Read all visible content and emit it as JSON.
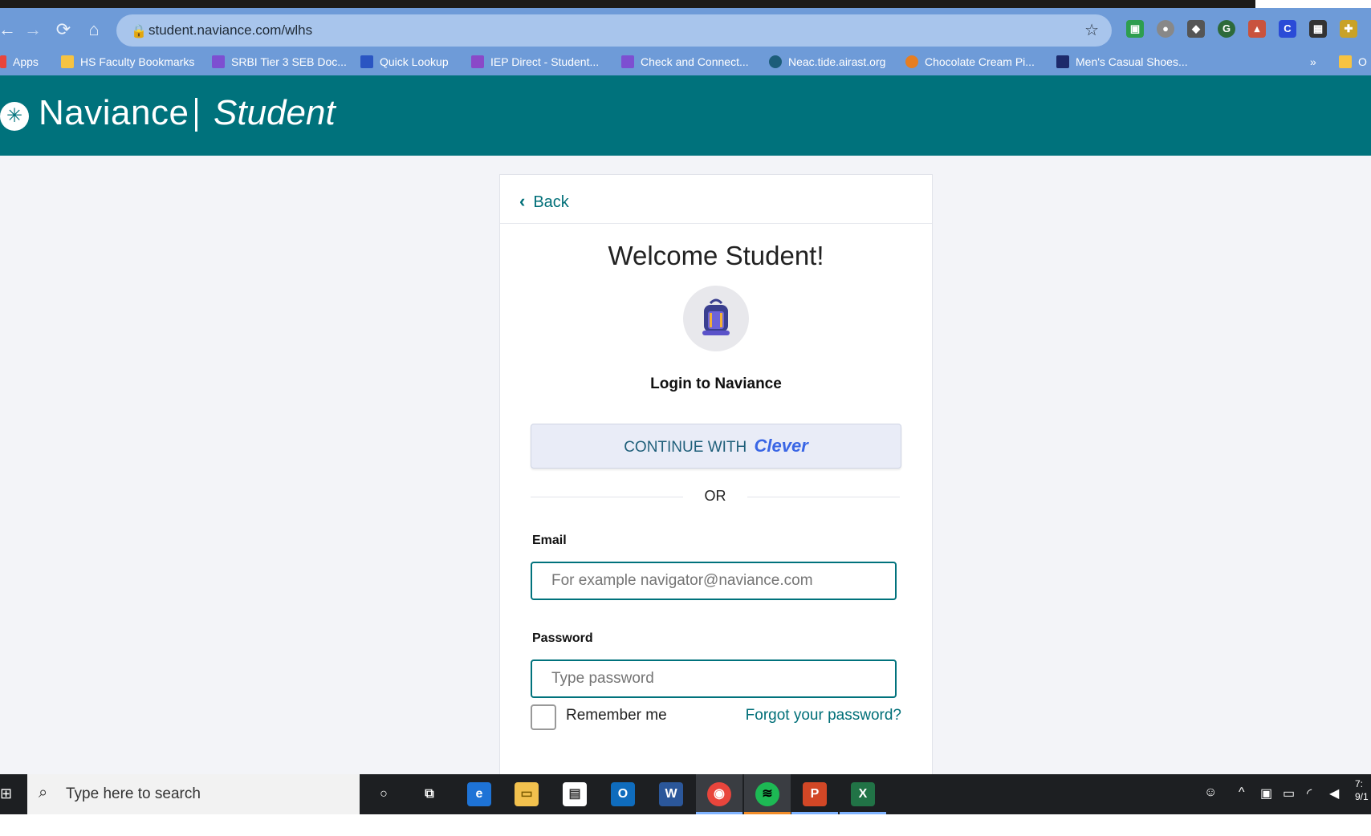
{
  "browser": {
    "url": "student.naviance.com/wlhs",
    "bookmarks": [
      {
        "label": "Apps",
        "color": "#e8453c"
      },
      {
        "label": "HS Faculty Bookmarks",
        "color": "#f6c342"
      },
      {
        "label": "SRBI Tier 3 SEB Doc...",
        "color": "#7d4fd1"
      },
      {
        "label": "Quick Lookup",
        "color": "#2a55c2"
      },
      {
        "label": "IEP Direct - Student...",
        "color": "#8a49c8"
      },
      {
        "label": "Check and Connect...",
        "color": "#7d4fd1"
      },
      {
        "label": "Neac.tide.airast.org",
        "color": "#1c5d7a"
      },
      {
        "label": "Chocolate Cream Pi...",
        "color": "#e67e22"
      },
      {
        "label": "Men's Casual Shoes...",
        "color": "#1d2a6b"
      },
      {
        "label": "»",
        "color": ""
      },
      {
        "label": "O",
        "color": "#f6c342"
      }
    ]
  },
  "header": {
    "brand": "Naviance",
    "subbrand": "Student"
  },
  "card": {
    "back_label": "Back",
    "welcome": "Welcome Student!",
    "login_title": "Login to Naviance",
    "clever_prefix": "CONTINUE WITH",
    "clever_brand": "Clever",
    "or_text": "OR",
    "email_label": "Email",
    "email_placeholder": "For example navigator@naviance.com",
    "password_label": "Password",
    "password_placeholder": "Type password",
    "remember_label": "Remember me",
    "forgot_label": "Forgot your password?"
  },
  "taskbar": {
    "search_placeholder": "Type here to search",
    "apps": [
      "cortana",
      "task-view",
      "edge",
      "file-explorer",
      "store",
      "outlook",
      "word",
      "chrome",
      "spotify",
      "powerpoint",
      "excel"
    ],
    "clock_time": "7:",
    "clock_date": "9/1"
  },
  "colors": {
    "header_teal": "#00727c",
    "browser_blue": "#6e9bd8",
    "accent_link": "#006f78",
    "clever_blue": "#3a66e5"
  }
}
